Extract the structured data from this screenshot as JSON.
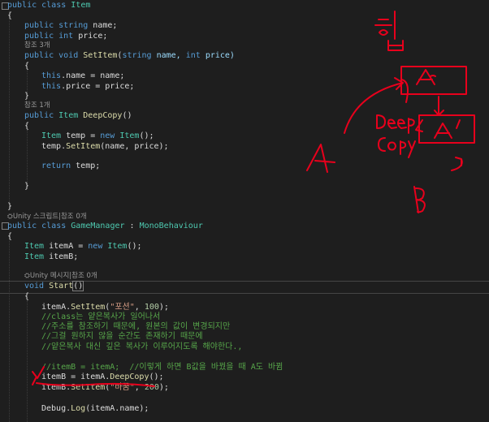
{
  "code": {
    "l01": {
      "a": "public class ",
      "b": "Item"
    },
    "l02": "{",
    "l03": {
      "a": "public string ",
      "b": "name;"
    },
    "l04": {
      "a": "public int ",
      "b": "price;"
    },
    "lens1": "참조 3개",
    "l05": {
      "a": "public void ",
      "b": "SetItem",
      "c": "(",
      "d": "string ",
      "e": "name, ",
      "f": "int ",
      "g": "price)"
    },
    "l06": "{",
    "l07": {
      "a": "this",
      "b": ".name = name;"
    },
    "l08": {
      "a": "this",
      "b": ".price = price;"
    },
    "l09": "}",
    "lens2": "참조 1개",
    "l10": {
      "a": "public ",
      "b": "Item ",
      "c": "DeepCopy",
      "d": "()"
    },
    "l11": "{",
    "l12": {
      "a": "Item ",
      "b": "temp = ",
      "c": "new ",
      "d": "Item",
      "e": "();"
    },
    "l13": {
      "a": "temp.",
      "b": "SetItem",
      "c": "(name, price);"
    },
    "l14": {
      "a": "return ",
      "b": "temp;"
    },
    "l15": "}",
    "l16": "}",
    "lens3": "Unity 스크립트|참조 0개",
    "l17": {
      "a": "public class ",
      "b": "GameManager ",
      "c": ": ",
      "d": "MonoBehaviour"
    },
    "l18": "{",
    "l19": {
      "a": "Item ",
      "b": "itemA = ",
      "c": "new ",
      "d": "Item",
      "e": "();"
    },
    "l20": {
      "a": "Item ",
      "b": "itemB;"
    },
    "lens4": "Unity 메시지|참조 0개",
    "l21": {
      "a": "void ",
      "b": "Start",
      "c": "()"
    },
    "l22": "{",
    "l23": {
      "a": "itemA.",
      "b": "SetItem",
      "c": "(",
      "d": "\"포션\"",
      "e": ", ",
      "f": "100",
      "g": ");"
    },
    "c1": "//class는 얕은복사가 일어나서",
    "c2": "//주소를 참조하기 때문에, 원본의 값이 변경되지만",
    "c3": "//그걸 원하지 않을 순간도 존재하기 때문에",
    "c4": "//얕은복사 대신 깊은 복사가 이루어지도록 해야한다.,",
    "c5": "//itemB = itemA;  //이렇게 하면 B값을 바꿨을 때 A도 바뀜",
    "l24": {
      "a": "itemB = itemA.",
      "b": "DeepCopy",
      "c": "();"
    },
    "l25": {
      "a": "itemB.",
      "b": "SetItem",
      "c": "(",
      "d": "\"바꿈\"",
      "e": ", ",
      "f": "200",
      "g": ");"
    },
    "l26": {
      "a": "Debug.",
      "b": "Log",
      "c": "(itemA.name);"
    }
  },
  "colors": {
    "background": "#1e1e1e",
    "keyword": "#569cd6",
    "type": "#4ec9b0",
    "method": "#dcdcaa",
    "string": "#d69d85",
    "number": "#b5cea8",
    "comment": "#57a64a",
    "annotation": "#e8001c"
  }
}
